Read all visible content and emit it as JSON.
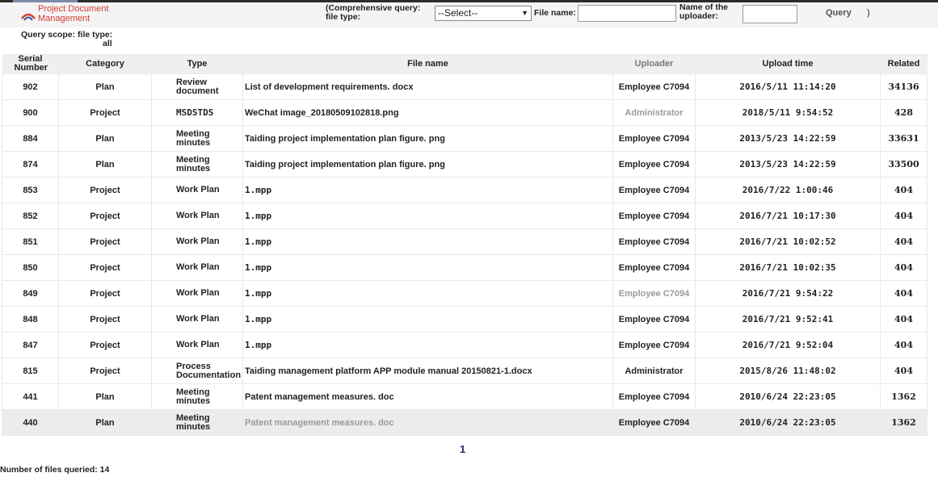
{
  "app": {
    "title": "Project Document Management"
  },
  "search": {
    "comprehensive_label": "(Comprehensive query: file type:",
    "file_type_selected": "--Select--",
    "file_name_label": "File name:",
    "file_name_value": "",
    "uploader_label": "Name of the uploader:",
    "uploader_value": "",
    "query_button": "Query",
    "closing_paren": ")"
  },
  "scope": {
    "label": "Query scope: file type:",
    "value": "all"
  },
  "table": {
    "headers": {
      "serial": "Serial Number",
      "category": "Category",
      "type": "Type",
      "file_name": "File name",
      "uploader": "Uploader",
      "upload_time": "Upload time",
      "related": "Related"
    },
    "rows": [
      {
        "serial": "902",
        "category": "Plan",
        "type": "Review document",
        "file_name": "List of development requirements. docx",
        "uploader": "Employee C7094",
        "upload_time": "2016/5/11 11:14:20",
        "related": "34136"
      },
      {
        "serial": "900",
        "category": "Project",
        "type": "MSDSTDS",
        "file_name": "WeChat image_20180509102818.png",
        "uploader": "Administrator",
        "upload_time": "2018/5/11 9:54:52",
        "related": "428"
      },
      {
        "serial": "884",
        "category": "Plan",
        "type": "Meeting minutes",
        "file_name": "Taiding project implementation plan figure. png",
        "uploader": "Employee C7094",
        "upload_time": "2013/5/23 14:22:59",
        "related": "33631"
      },
      {
        "serial": "874",
        "category": "Plan",
        "type": "Meeting minutes",
        "file_name": "Taiding project implementation plan figure. png",
        "uploader": "Employee C7094",
        "upload_time": "2013/5/23 14:22:59",
        "related": "33500"
      },
      {
        "serial": "853",
        "category": "Project",
        "type": "Work Plan",
        "file_name": "1.mpp",
        "uploader": "Employee C7094",
        "upload_time": "2016/7/22 1:00:46",
        "related": "404"
      },
      {
        "serial": "852",
        "category": "Project",
        "type": "Work Plan",
        "file_name": "1.mpp",
        "uploader": "Employee C7094",
        "upload_time": "2016/7/21 10:17:30",
        "related": "404"
      },
      {
        "serial": "851",
        "category": "Project",
        "type": "Work Plan",
        "file_name": "1.mpp",
        "uploader": "Employee C7094",
        "upload_time": "2016/7/21 10:02:52",
        "related": "404"
      },
      {
        "serial": "850",
        "category": "Project",
        "type": "Work Plan",
        "file_name": "1.mpp",
        "uploader": "Employee C7094",
        "upload_time": "2016/7/21 10:02:35",
        "related": "404"
      },
      {
        "serial": "849",
        "category": "Project",
        "type": "Work Plan",
        "file_name": "1.mpp",
        "uploader": "Employee C7094",
        "upload_time": "2016/7/21 9:54:22",
        "related": "404"
      },
      {
        "serial": "848",
        "category": "Project",
        "type": "Work Plan",
        "file_name": "1.mpp",
        "uploader": "Employee C7094",
        "upload_time": "2016/7/21 9:52:41",
        "related": "404"
      },
      {
        "serial": "847",
        "category": "Project",
        "type": "Work Plan",
        "file_name": "1.mpp",
        "uploader": "Employee C7094",
        "upload_time": "2016/7/21 9:52:04",
        "related": "404"
      },
      {
        "serial": "815",
        "category": "Project",
        "type": "Process Documentation",
        "file_name": "Taiding management platform APP module manual 20150821-1.docx",
        "uploader": "Administrator",
        "upload_time": "2015/8/26 11:48:02",
        "related": "404"
      },
      {
        "serial": "441",
        "category": "Plan",
        "type": "Meeting minutes",
        "file_name": "Patent management measures. doc",
        "uploader": "Employee C7094",
        "upload_time": "2010/6/24 22:23:05",
        "related": "1362"
      },
      {
        "serial": "440",
        "category": "Plan",
        "type": "Meeting minutes",
        "file_name": "Patent management measures. doc",
        "uploader": "Employee C7094",
        "upload_time": "2010/6/24 22:23:05",
        "related": "1362"
      }
    ]
  },
  "pagination": {
    "current_page": "1"
  },
  "footer": {
    "count_text": "Number of files queried: 14"
  },
  "colors": {
    "brand": "#d63b2f",
    "pager": "#1d2c6b",
    "header_bg": "#efefef"
  },
  "icons": {
    "logo": "cloud-logo-icon"
  }
}
